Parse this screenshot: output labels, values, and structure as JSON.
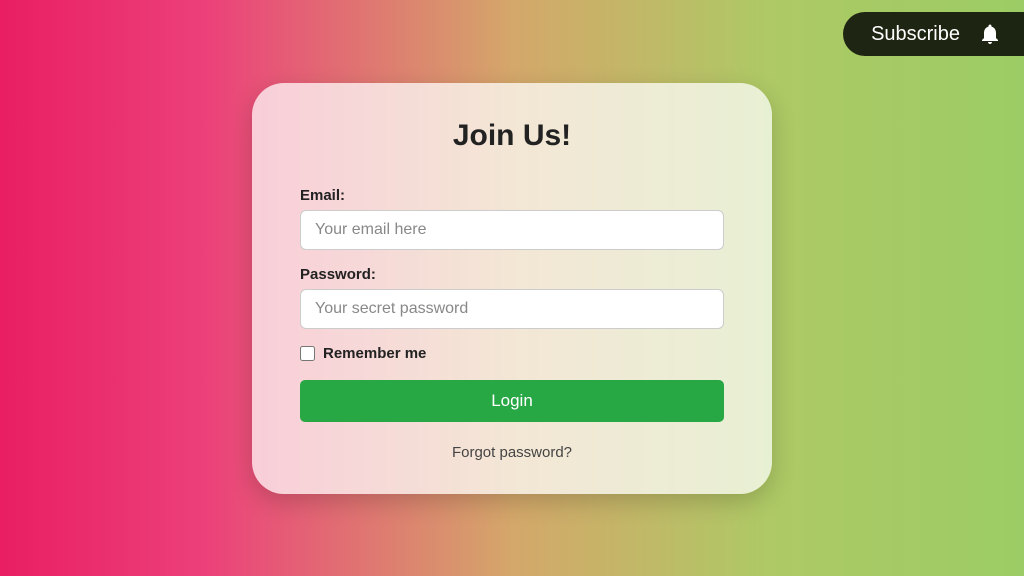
{
  "subscribe": {
    "label": "Subscribe"
  },
  "card": {
    "title": "Join Us!",
    "email_label": "Email:",
    "email_placeholder": "Your email here",
    "password_label": "Password:",
    "password_placeholder": "Your secret password",
    "remember_label": "Remember me",
    "login_button": "Login",
    "forgot_link": "Forgot password?"
  }
}
